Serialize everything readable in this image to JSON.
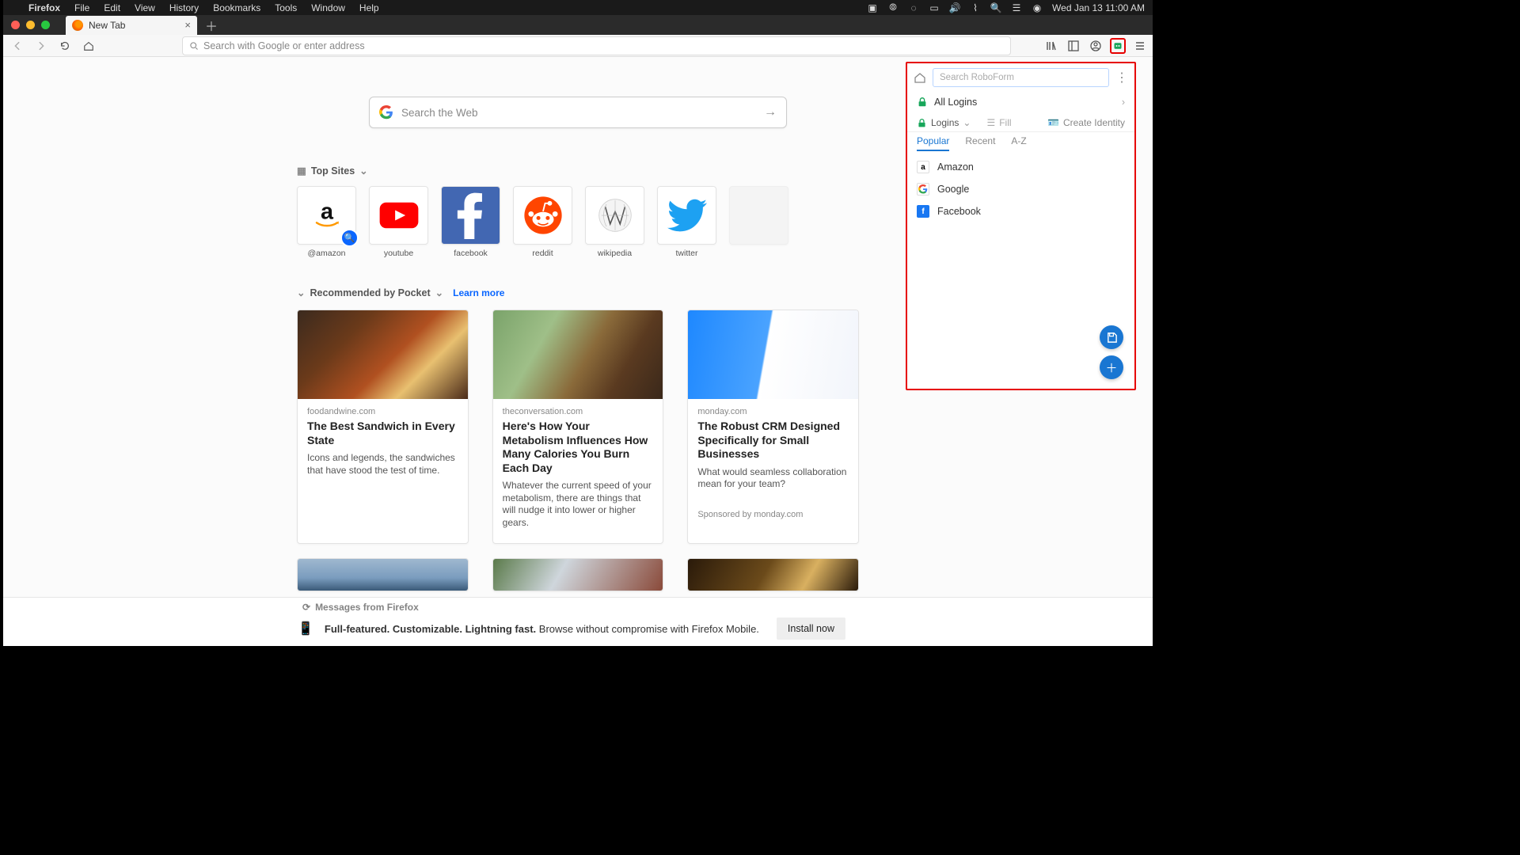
{
  "menubar": {
    "app": "Firefox",
    "items": [
      "File",
      "Edit",
      "View",
      "History",
      "Bookmarks",
      "Tools",
      "Window",
      "Help"
    ],
    "clock": "Wed Jan 13  11:00 AM"
  },
  "tab": {
    "title": "New Tab"
  },
  "urlbar": {
    "placeholder": "Search with Google or enter address"
  },
  "search": {
    "placeholder": "Search the Web"
  },
  "sections": {
    "topsites": "Top Sites",
    "pocket": "Recommended by Pocket",
    "learn": "Learn more"
  },
  "topsites": [
    {
      "label": "@amazon",
      "kind": "amazon"
    },
    {
      "label": "youtube",
      "kind": "youtube"
    },
    {
      "label": "facebook",
      "kind": "facebook"
    },
    {
      "label": "reddit",
      "kind": "reddit"
    },
    {
      "label": "wikipedia",
      "kind": "wikipedia"
    },
    {
      "label": "twitter",
      "kind": "twitter"
    },
    {
      "label": "",
      "kind": "blank"
    }
  ],
  "cards": [
    {
      "source": "foodandwine.com",
      "title": "The Best Sandwich in Every State",
      "desc": "Icons and legends, the sandwiches that have stood the test of time.",
      "img_bg": "linear-gradient(135deg,#3b2a1e 0%,#6b3a1a 30%,#b05020 55%,#e8c070 72%,#4a2a18 100%)"
    },
    {
      "source": "theconversation.com",
      "title": "Here's How Your Metabolism Influences How Many Calories You Burn Each Day",
      "desc": "Whatever the current speed of your metabolism, there are things that will nudge it into lower or higher gears.",
      "img_bg": "linear-gradient(120deg,#7aa36a 0%,#9fbf88 30%,#8a6a3a 55%,#5a3a20 75%,#3a281a 100%)"
    },
    {
      "source": "monday.com",
      "title": "The Robust CRM Designed Specifically for Small Businesses",
      "desc": "What would seamless collaboration mean for your team?",
      "sponsored": "Sponsored by monday.com",
      "img_bg": "linear-gradient(100deg,#1e88ff 0%,#4aa3ff 45%,#ffffff 46%,#f2f5fb 100%)"
    }
  ],
  "row2_bgs": [
    "linear-gradient(180deg,#9fb8cf 0%,#7a9cbe 60%,#3a5a78 100%)",
    "linear-gradient(120deg,#5a7a4a 0%,#cfd6dc 40%,#8a4a3a 100%)",
    "linear-gradient(120deg,#2a1a0a 0%,#6b4a1a 45%,#d9b060 70%,#2a1a0a 100%)"
  ],
  "msgbar": {
    "header": "Messages from Firefox",
    "bold": "Full-featured. Customizable. Lightning fast.",
    "rest": " Browse without compromise with Firefox Mobile.",
    "button": "Install now"
  },
  "roboform": {
    "search_placeholder": "Search RoboForm",
    "all_logins": "All Logins",
    "logins": "Logins",
    "fill": "Fill",
    "create_identity": "Create Identity",
    "tabs": [
      "Popular",
      "Recent",
      "A-Z"
    ],
    "items": [
      {
        "label": "Amazon",
        "bg": "#fff",
        "fg": "#000",
        "letter": "a"
      },
      {
        "label": "Google",
        "bg": "#fff",
        "fg": "#000",
        "letter": "G"
      },
      {
        "label": "Facebook",
        "bg": "#1877f2",
        "fg": "#fff",
        "letter": "f"
      }
    ]
  }
}
